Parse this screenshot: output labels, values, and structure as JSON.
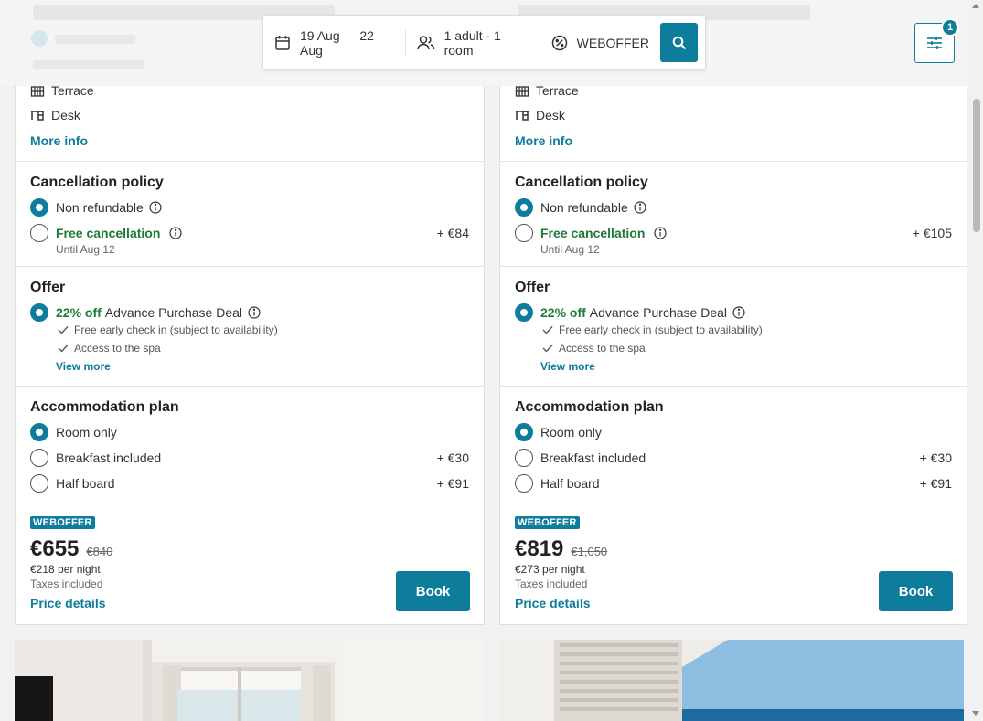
{
  "search": {
    "dates": "19 Aug — 22 Aug",
    "guests": "1 adult · 1 room",
    "promo": "WEBOFFER",
    "filter_count": "1"
  },
  "colors": {
    "accent": "#0e7c9b",
    "green": "#1f7a3a"
  },
  "icons": {
    "calendar": "calendar-icon",
    "guests": "users-icon",
    "promo": "percent-icon",
    "search": "search-icon",
    "filter": "sliders-icon"
  },
  "rooms": [
    {
      "amenities": [
        "Terrace",
        "Desk"
      ],
      "more_info": "More info",
      "cancellation": {
        "title": "Cancellation policy",
        "options": [
          {
            "label": "Non refundable",
            "selected": true,
            "price": ""
          },
          {
            "label": "Free cancellation",
            "selected": false,
            "price": "+ €84",
            "note": "Until Aug 12"
          }
        ]
      },
      "offer": {
        "title": "Offer",
        "discount": "22% off",
        "name": "Advance Purchase Deal",
        "benefits": [
          "Free early check in (subject to availability)",
          "Access to the spa"
        ],
        "view_more": "View more"
      },
      "plan": {
        "title": "Accommodation plan",
        "options": [
          {
            "label": "Room only",
            "selected": true,
            "price": ""
          },
          {
            "label": "Breakfast included",
            "selected": false,
            "price": "+ €30"
          },
          {
            "label": "Half board",
            "selected": false,
            "price": "+ €91"
          }
        ]
      },
      "pricing": {
        "badge": "WEBOFFER",
        "price": "€655",
        "old_price": "€840",
        "per_night": "€218 per night",
        "taxes": "Taxes included",
        "details": "Price details",
        "book": "Book"
      }
    },
    {
      "amenities": [
        "Terrace",
        "Desk"
      ],
      "more_info": "More info",
      "cancellation": {
        "title": "Cancellation policy",
        "options": [
          {
            "label": "Non refundable",
            "selected": true,
            "price": ""
          },
          {
            "label": "Free cancellation",
            "selected": false,
            "price": "+ €105",
            "note": "Until Aug 12"
          }
        ]
      },
      "offer": {
        "title": "Offer",
        "discount": "22% off",
        "name": "Advance Purchase Deal",
        "benefits": [
          "Free early check in (subject to availability)",
          "Access to the spa"
        ],
        "view_more": "View more"
      },
      "plan": {
        "title": "Accommodation plan",
        "options": [
          {
            "label": "Room only",
            "selected": true,
            "price": ""
          },
          {
            "label": "Breakfast included",
            "selected": false,
            "price": "+ €30"
          },
          {
            "label": "Half board",
            "selected": false,
            "price": "+ €91"
          }
        ]
      },
      "pricing": {
        "badge": "WEBOFFER",
        "price": "€819",
        "old_price": "€1,050",
        "per_night": "€273 per night",
        "taxes": "Taxes included",
        "details": "Price details",
        "book": "Book"
      }
    }
  ]
}
